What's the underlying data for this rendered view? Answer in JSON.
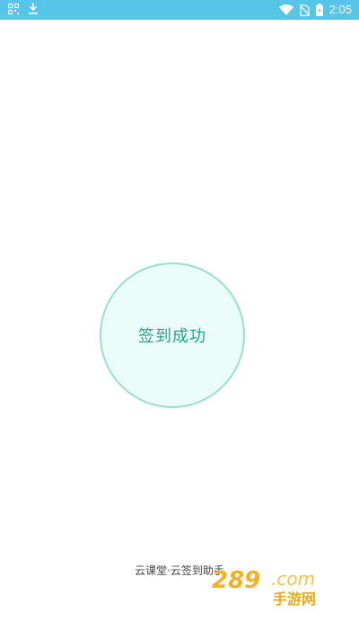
{
  "status_bar": {
    "time": "2:05",
    "bg_color": "#57c5e8",
    "icons_left": [
      "qr-scan-icon",
      "download-icon"
    ],
    "icons_right": [
      "wifi-icon",
      "no-sim-icon",
      "battery-icon"
    ]
  },
  "main": {
    "status_label": "签到成功",
    "circle_fill": "#eafdf9",
    "circle_border": "#9bdfca",
    "text_color": "#26a284"
  },
  "footer": {
    "app_name": "云课堂·云签到助手"
  },
  "watermark": {
    "logo_text": "289.com 手游网"
  }
}
